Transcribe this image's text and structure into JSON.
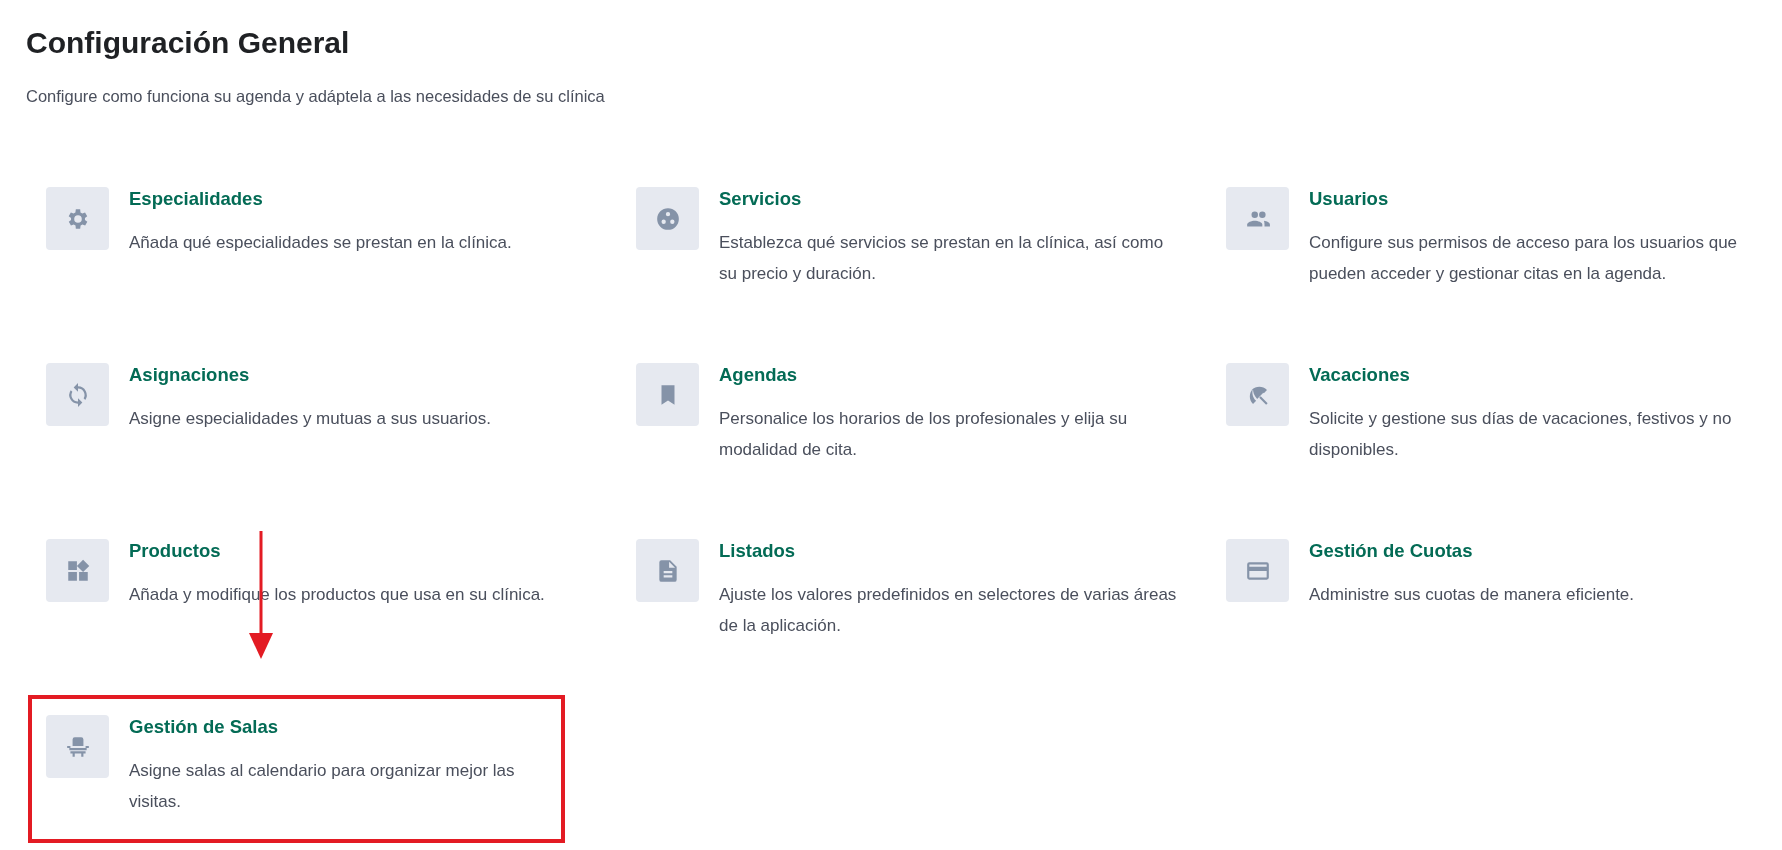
{
  "header": {
    "title": "Configuración General",
    "subtitle": "Configure como funciona su agenda y adáptela a las necesidades de su clínica"
  },
  "sections": [
    {
      "title": "Especialidades",
      "description": "Añada qué especialidades se prestan en la clínica.",
      "highlighted": false
    },
    {
      "title": "Servicios",
      "description": "Establezca qué servicios se prestan en la clínica, así como su precio y duración.",
      "highlighted": false
    },
    {
      "title": "Usuarios",
      "description": "Configure sus permisos de acceso para los usuarios que pueden acceder y gestionar citas en la agenda.",
      "highlighted": false
    },
    {
      "title": "Asignaciones",
      "description": "Asigne especialidades y mutuas a sus usuarios.",
      "highlighted": false
    },
    {
      "title": "Agendas",
      "description": "Personalice los horarios de los profesionales y elija su modalidad de cita.",
      "highlighted": false
    },
    {
      "title": "Vacaciones",
      "description": "Solicite y gestione sus días de vacaciones, festivos y no disponibles.",
      "highlighted": false
    },
    {
      "title": "Productos",
      "description": "Añada y modifique los productos que usa en su clínica.",
      "highlighted": false
    },
    {
      "title": "Listados",
      "description": "Ajuste los valores predefinidos en selectores de varias áreas de la aplicación.",
      "highlighted": false
    },
    {
      "title": "Gestión de Cuotas",
      "description": "Administre sus cuotas de manera eficiente.",
      "highlighted": false
    },
    {
      "title": "Gestión de Salas",
      "description": "Asigne salas al calendario para organizar mejor las visitas.",
      "highlighted": true
    }
  ]
}
